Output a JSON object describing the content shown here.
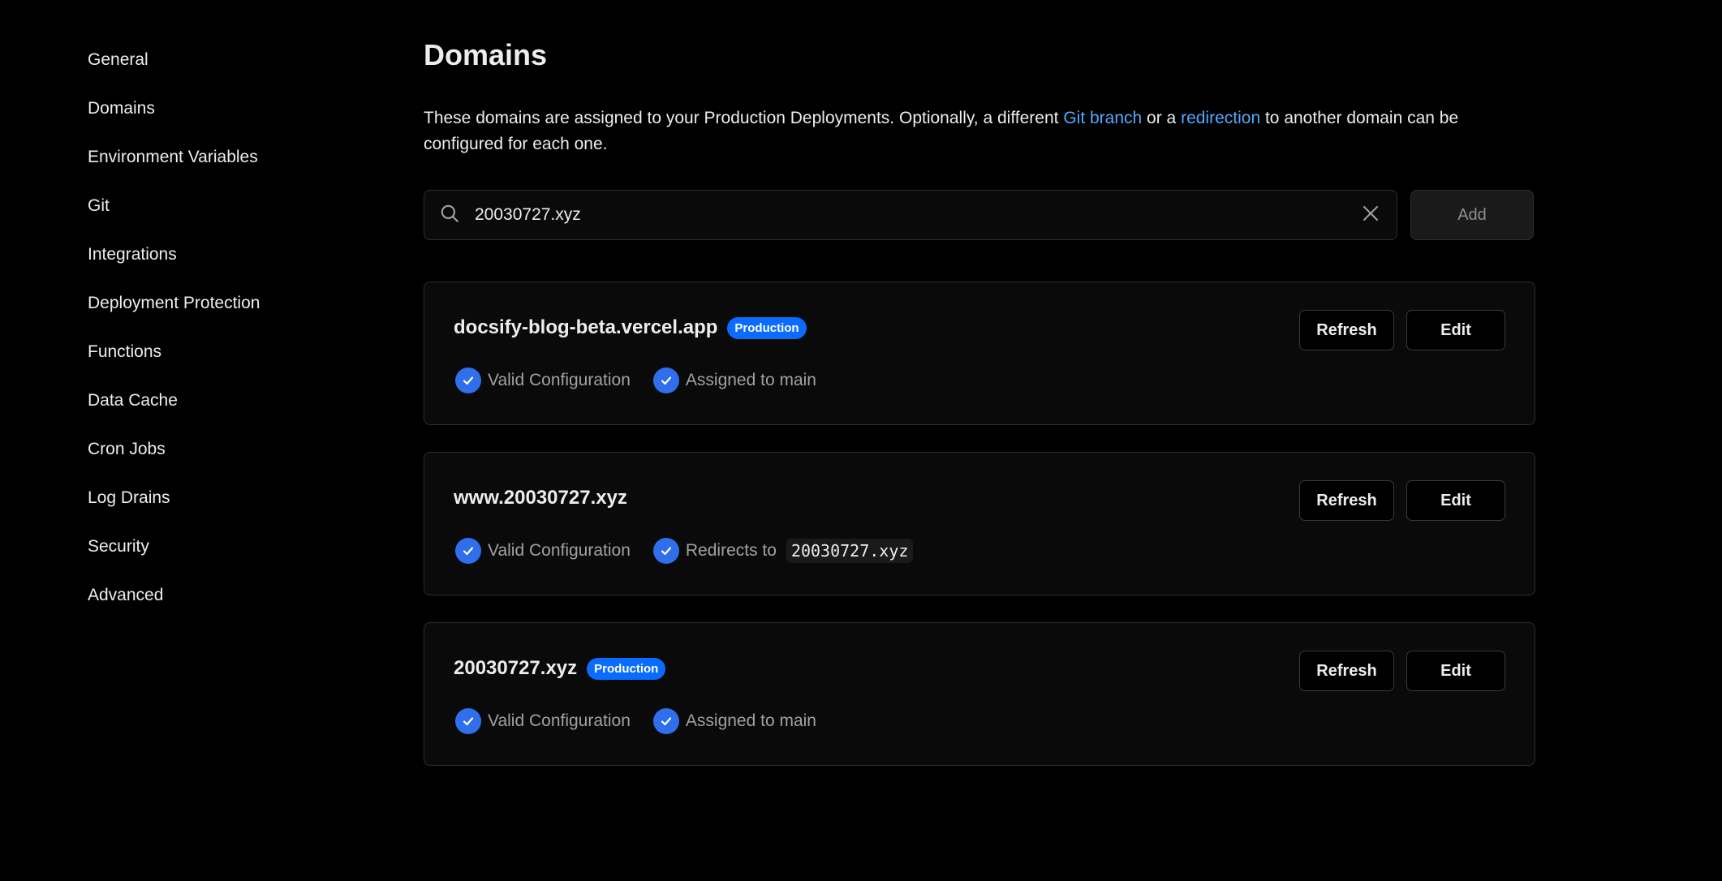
{
  "sidebar": {
    "items": [
      {
        "label": "General"
      },
      {
        "label": "Domains"
      },
      {
        "label": "Environment Variables"
      },
      {
        "label": "Git"
      },
      {
        "label": "Integrations"
      },
      {
        "label": "Deployment Protection"
      },
      {
        "label": "Functions"
      },
      {
        "label": "Data Cache"
      },
      {
        "label": "Cron Jobs"
      },
      {
        "label": "Log Drains"
      },
      {
        "label": "Security"
      },
      {
        "label": "Advanced"
      }
    ]
  },
  "main": {
    "title": "Domains",
    "description": {
      "part1": "These domains are assigned to your Production Deployments. Optionally, a different ",
      "link1": "Git branch",
      "part2": " or a ",
      "link2": "redirection",
      "part3": " to another domain can be configured for each one."
    },
    "search": {
      "value": "20030727.xyz",
      "icon": "search-icon",
      "clear_icon": "close-icon"
    },
    "add_label": "Add",
    "domains": [
      {
        "name": "docsify-blog-beta.vercel.app",
        "badge": "Production",
        "status1": "Valid Configuration",
        "status2": "Assigned to main",
        "refresh_label": "Refresh",
        "edit_label": "Edit"
      },
      {
        "name": "www.20030727.xyz",
        "status1": "Valid Configuration",
        "status2": "Redirects to",
        "redirect_target": "20030727.xyz",
        "refresh_label": "Refresh",
        "edit_label": "Edit"
      },
      {
        "name": "20030727.xyz",
        "badge": "Production",
        "status1": "Valid Configuration",
        "status2": "Assigned to main",
        "refresh_label": "Refresh",
        "edit_label": "Edit"
      }
    ]
  },
  "colors": {
    "background": "#000000",
    "link": "#52a8ff",
    "badge": "#0a6cff",
    "check": "#2f6fec"
  }
}
